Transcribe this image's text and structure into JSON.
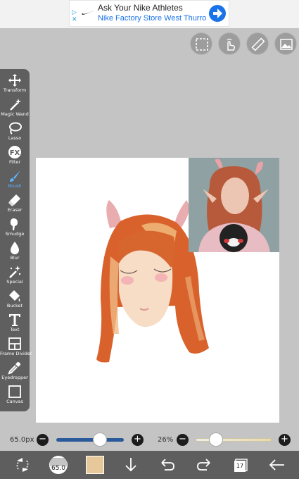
{
  "ad": {
    "title": "Ask Your Nike Athletes",
    "subtitle": "Nike Factory Store West Thurro"
  },
  "tools": [
    {
      "label": "Transform",
      "icon": "move-arrows-icon"
    },
    {
      "label": "Magic Wand",
      "icon": "magic-wand-icon"
    },
    {
      "label": "Lasso",
      "icon": "lasso-icon"
    },
    {
      "label": "Filter",
      "icon": "fx-icon"
    },
    {
      "label": "Brush",
      "icon": "brush-icon"
    },
    {
      "label": "Eraser",
      "icon": "eraser-icon"
    },
    {
      "label": "Smudge",
      "icon": "smudge-icon"
    },
    {
      "label": "Blur",
      "icon": "blur-drop-icon"
    },
    {
      "label": "Special",
      "icon": "special-wand-icon"
    },
    {
      "label": "Bucket",
      "icon": "bucket-icon"
    },
    {
      "label": "Text",
      "icon": "text-icon"
    },
    {
      "label": "Frame Divider",
      "icon": "frame-divider-icon"
    },
    {
      "label": "Eyedropper",
      "icon": "eyedropper-icon"
    },
    {
      "label": "Canvas",
      "icon": "canvas-icon"
    }
  ],
  "active_tool": "Brush",
  "sliders": {
    "size_label": "65.0px",
    "size_fraction": 0.68,
    "opacity_label": "26%",
    "opacity_fraction": 0.26,
    "minus": "−",
    "plus": "+"
  },
  "bottom": {
    "brush_size_badge": "65.0",
    "layers_count": "17"
  },
  "colors": {
    "accent_blue": "#1a73e8",
    "active_tool": "#5fb4ff",
    "size_track": "#2a5a9a",
    "hair": "#d9622c"
  }
}
